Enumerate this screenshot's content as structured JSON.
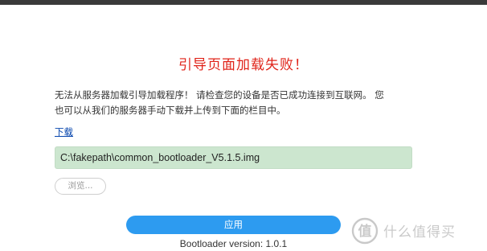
{
  "page": {
    "title": "引导页面加载失败！",
    "message_line1": "无法从服务器加载引导加载程序！ 请检查您的设备是否已成功连接到互联网。 您",
    "message_line2": "也可以从我们的服务器手动下载并上传到下面的栏目中。",
    "download_label": "下载",
    "file_path_value": "C:\\fakepath\\common_bootloader_V5.1.5.img",
    "browse_label": "浏览...",
    "apply_label": "应用",
    "version_text": "Bootloader version: 1.0.1"
  },
  "watermark": {
    "text": "什么值得买",
    "icon": "smzdm-logo-icon"
  },
  "colors": {
    "title": "#e0241a",
    "apply_button": "#2d9bf0",
    "file_field_bg": "#cce6cf",
    "link": "#0645ad"
  }
}
